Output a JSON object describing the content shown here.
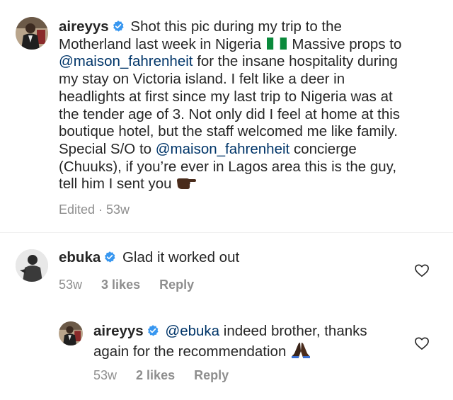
{
  "post": {
    "username": "aireyys",
    "caption_line_1": "Shot this pic during my trip to the",
    "caption_line_2a": "Motherland last week in Nigeria",
    "caption_line_2b": "Massive props to",
    "caption_mention_1": "@maison_fahrenheit",
    "caption_line_3b": "for the insane hospitality during",
    "caption_line_4": "my stay on Victoria island. I felt like a deer in",
    "caption_line_5": "headlights at first since my last trip to Nigeria was at",
    "caption_line_6": "the tender age of 3. Not only did I feel at home at this",
    "caption_line_7": "boutique hotel, but the staff welcomed me like family.",
    "caption_line_8a": "Special S/O to",
    "caption_mention_2": "@maison_fahrenheit",
    "caption_line_8b": "concierge",
    "caption_line_9": "(Chuuks), if you’re ever in Lagos area this is the guy,",
    "caption_line_10": "tell him I sent you",
    "edited_label": "Edited · 53w",
    "flag_icon": "nigeria-flag",
    "emoji_icon": "backhand-index-pointing-left"
  },
  "comment_1": {
    "username": "ebuka",
    "text": "Glad it worked out",
    "time": "53w",
    "likes": "3 likes",
    "reply": "Reply"
  },
  "reply_1": {
    "username": "aireyys",
    "mention": "@ebuka",
    "text_line_1": "indeed brother, thanks",
    "text_line_2": "again for the recommendation",
    "time": "53w",
    "likes": "2 likes",
    "reply": "Reply",
    "emoji_icon": "folded-hands"
  },
  "colors": {
    "verified_blue": "#3897f0",
    "mention": "#003569",
    "meta_gray": "#8e8e8e",
    "text": "#262626"
  }
}
